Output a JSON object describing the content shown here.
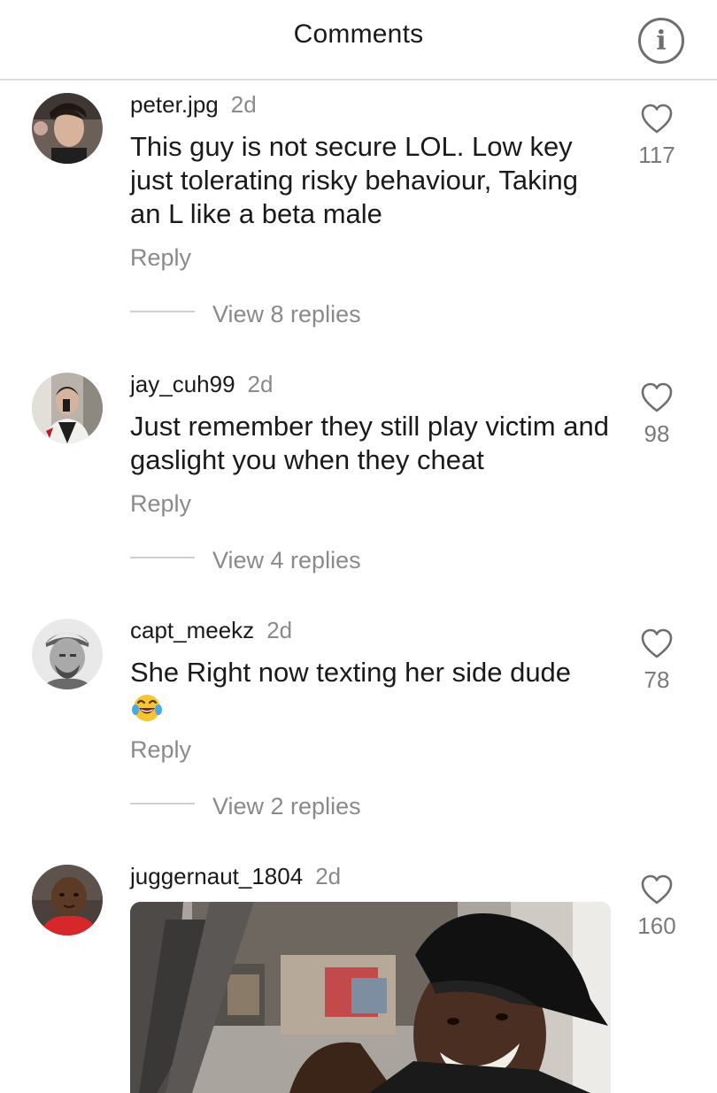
{
  "header": {
    "title": "Comments",
    "info_icon": "info-circle-icon"
  },
  "comments": [
    {
      "username": "peter.jpg",
      "time": "2d",
      "text": "This guy is not secure LOL. Low key just tolerating risky behaviour, Taking an L like a beta male",
      "reply_label": "Reply",
      "view_replies": "View 8 replies",
      "likes": "117"
    },
    {
      "username": "jay_cuh99",
      "time": "2d",
      "text": "Just remember they still play victim and gaslight you when they cheat",
      "reply_label": "Reply",
      "view_replies": "View 4 replies",
      "likes": "98"
    },
    {
      "username": "capt_meekz",
      "time": "2d",
      "text": "She Right now texting her side dude",
      "emoji": "face-with-tears-of-joy",
      "reply_label": "Reply",
      "view_replies": "View 2 replies",
      "likes": "78"
    },
    {
      "username": "juggernaut_1804",
      "time": "2d",
      "attachment": "gif-image",
      "likes": "160"
    }
  ],
  "colors": {
    "text_primary": "#1a1a1a",
    "text_secondary": "#8a8a8a",
    "divider": "#dcdcdc",
    "icon_gray": "#6e6e6e"
  }
}
